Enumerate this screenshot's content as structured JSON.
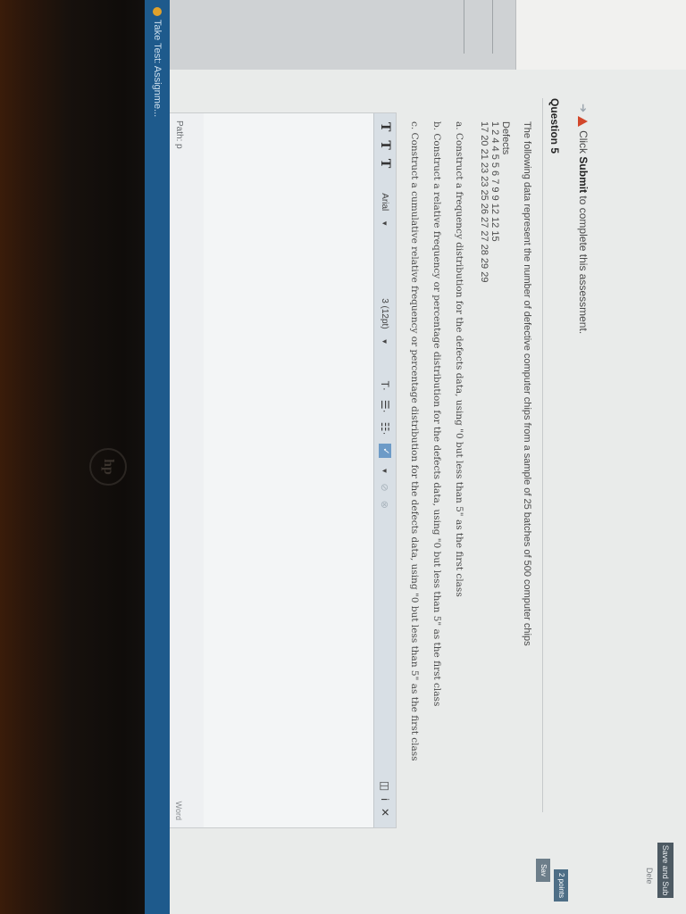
{
  "taskbar": {
    "item": "Take Test: Assignme..."
  },
  "toolbar_right": {
    "save_submit": "Save and Sub",
    "delete": "Dele",
    "points": "2 points",
    "save": "Sav"
  },
  "notice": {
    "prefix": "Click ",
    "bold": "Submit",
    "suffix": " to complete this assessment."
  },
  "question": {
    "title": "Question 5",
    "text": "The following data represent the number of defective computer chips from a sample of 25 batches of 500 computer chips",
    "defects_label": "Defects",
    "defects_row1": "1 2 4 4 5 5 6 7 9 9 12 12 15",
    "defects_row2": "17   20 21 23 23 25 26 27 27 28 29 29",
    "part_a": "a.  Construct a frequency distribution for the defects data, using \"0 but less than 5\" as the first class",
    "part_b": "b.  Construct a relative frequency or percentage distribution for the defects data, using \"0 but less than 5\" as the first class",
    "part_c": "c.  Construct a cumulative relative frequency or percentage distribution for the defects data, using \"0 but less than 5\" as the first class"
  },
  "editor": {
    "font": "Arial",
    "size": "3 (12pt)",
    "path_label": "Path: p",
    "words_label": "Word"
  }
}
